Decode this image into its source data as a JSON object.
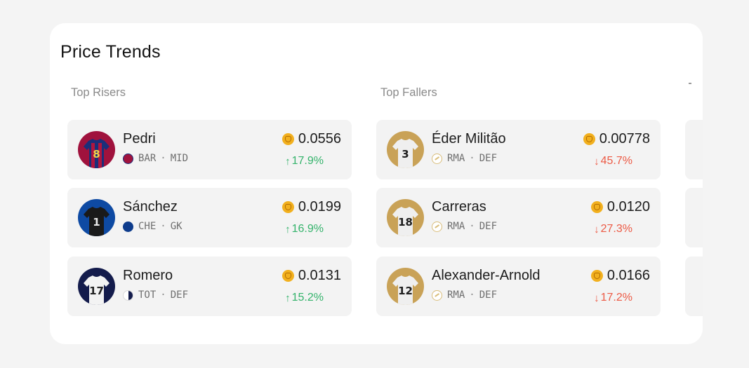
{
  "title": "Price Trends",
  "sections": {
    "risers": {
      "label": "Top Risers",
      "players": [
        {
          "name": "Pedri",
          "club": "BAR",
          "position": "MID",
          "price": "0.0556",
          "change": "17.9%",
          "direction": "up",
          "shirt_number": "8"
        },
        {
          "name": "Sánchez",
          "club": "CHE",
          "position": "GK",
          "price": "0.0199",
          "change": "16.9%",
          "direction": "up",
          "shirt_number": "1"
        },
        {
          "name": "Romero",
          "club": "TOT",
          "position": "DEF",
          "price": "0.0131",
          "change": "15.2%",
          "direction": "up",
          "shirt_number": "17"
        }
      ]
    },
    "fallers": {
      "label": "Top Fallers",
      "players": [
        {
          "name": "Éder Militão",
          "club": "RMA",
          "position": "DEF",
          "price": "0.00778",
          "change": "45.7%",
          "direction": "down",
          "shirt_number": "3"
        },
        {
          "name": "Carreras",
          "club": "RMA",
          "position": "DEF",
          "price": "0.0120",
          "change": "27.3%",
          "direction": "down",
          "shirt_number": "18"
        },
        {
          "name": "Alexander-Arnold",
          "club": "RMA",
          "position": "DEF",
          "price": "0.0166",
          "change": "17.2%",
          "direction": "down",
          "shirt_number": "12"
        }
      ]
    }
  },
  "separator": "·",
  "arrows": {
    "up": "↑",
    "down": "↓"
  },
  "colors": {
    "up": "#34b36b",
    "down": "#ec5a45",
    "coin": "#f2b01e",
    "card": "#ffffff",
    "row": "#f3f3f3"
  },
  "icons": {
    "price": "coin-icon"
  }
}
